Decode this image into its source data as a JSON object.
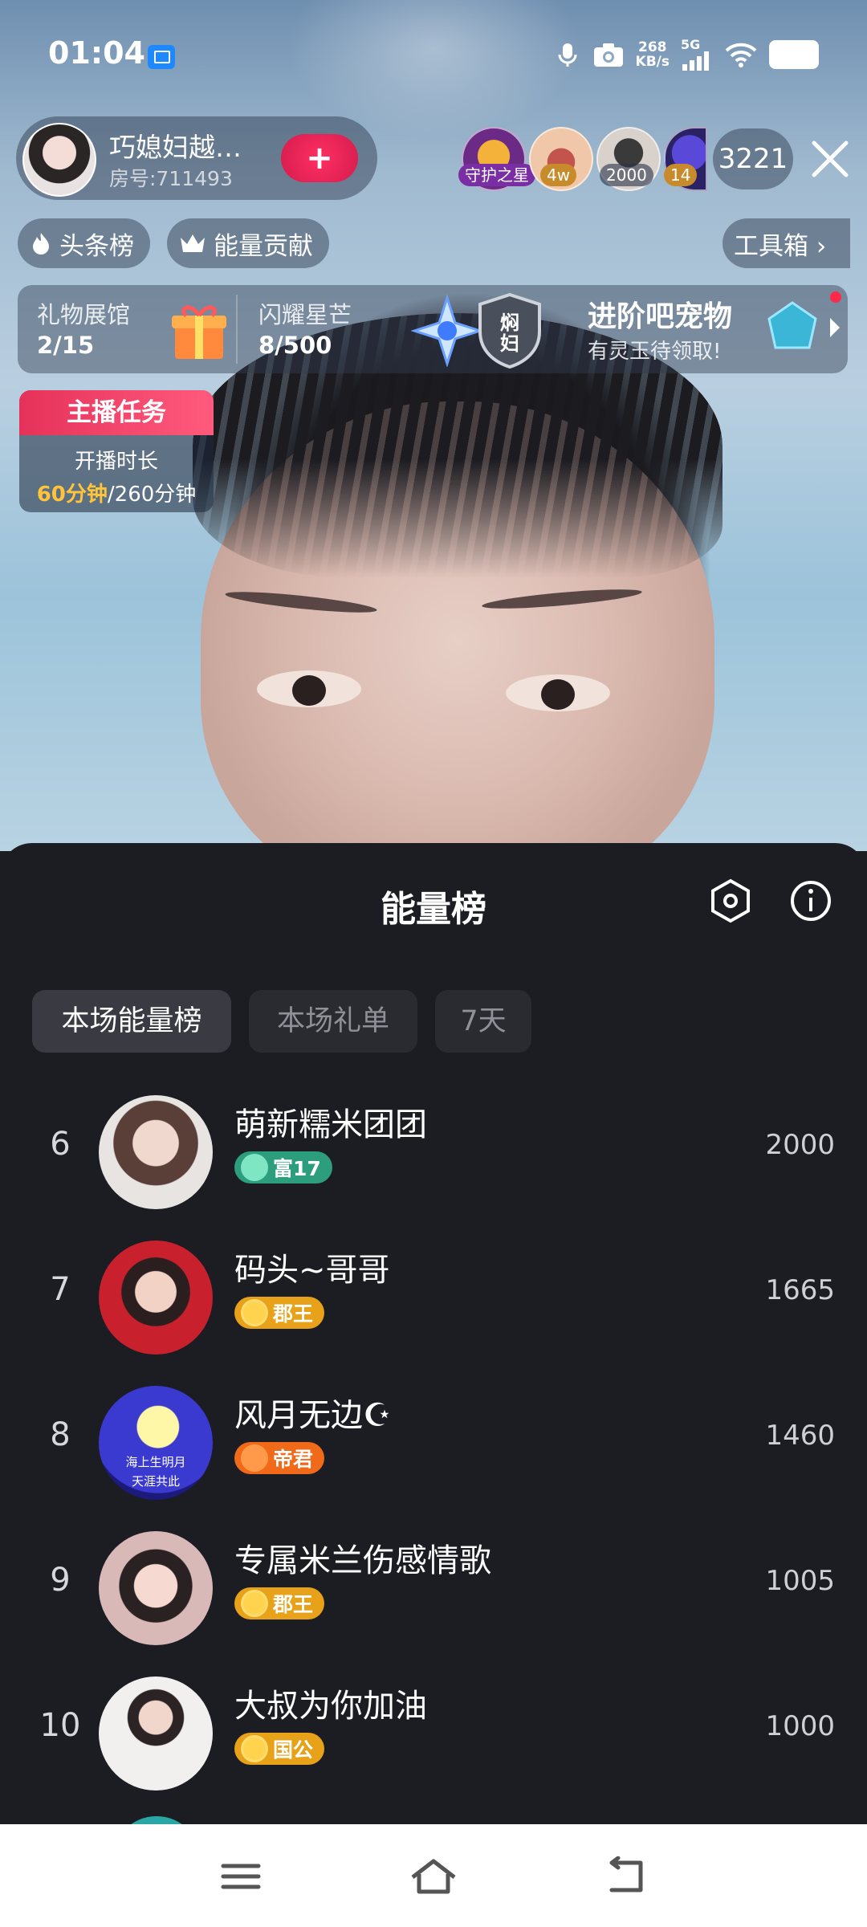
{
  "status_bar": {
    "time": "01:04",
    "net_speed_value": "268",
    "net_speed_unit": "KB/s",
    "network": "5G",
    "icons": [
      "cast-icon",
      "mic-icon",
      "camera-icon",
      "signal-icon",
      "wifi-icon",
      "battery-icon"
    ]
  },
  "host": {
    "name": "巧媳妇越…",
    "room": "房号:711493",
    "follow_symbol": "+"
  },
  "viewers": {
    "tags": [
      "守护之星",
      "4w",
      "2000",
      "14"
    ],
    "count": "3221"
  },
  "chips": {
    "headline": "头条榜",
    "energy_contribution": "能量贡献",
    "toolbox": "工具箱 ›"
  },
  "activity": {
    "gift_hall_title": "礼物展馆",
    "gift_hall_value": "2/15",
    "star_title": "闪耀星芒",
    "star_value": "8/500",
    "shield_text": "焖妇",
    "promo_title": "进阶吧宠物",
    "promo_sub": "有灵玉待领取!"
  },
  "task": {
    "title": "主播任务",
    "label": "开播时长",
    "done": "60分钟",
    "total": "/260分钟"
  },
  "sheet": {
    "title": "能量榜",
    "tabs": [
      "本场能量榜",
      "本场礼单",
      "7天"
    ],
    "active_tab": 0,
    "rows": [
      {
        "rank": "6",
        "name": "萌新糯米团团",
        "badge": "富17",
        "badge_style": "fu",
        "score": "2000"
      },
      {
        "rank": "7",
        "name": "码头~哥哥",
        "badge": "郡王",
        "badge_style": "wang",
        "score": "1665"
      },
      {
        "rank": "8",
        "name": "风月无边☪",
        "badge": "帝君",
        "badge_style": "di",
        "score": "1460"
      },
      {
        "rank": "9",
        "name": "专属米兰伤感情歌",
        "badge": "郡王",
        "badge_style": "wang",
        "score": "1005"
      },
      {
        "rank": "10",
        "name": "大叔为你加油",
        "badge": "国公",
        "badge_style": "wang",
        "score": "1000"
      }
    ],
    "avatar8_text_top": "海上生明月",
    "avatar8_text_bottom": "天涯共此"
  },
  "colors": {
    "sheet_bg": "#1c1d22",
    "accent_pink": "#e6325a",
    "task_highlight": "#ffc43a"
  }
}
